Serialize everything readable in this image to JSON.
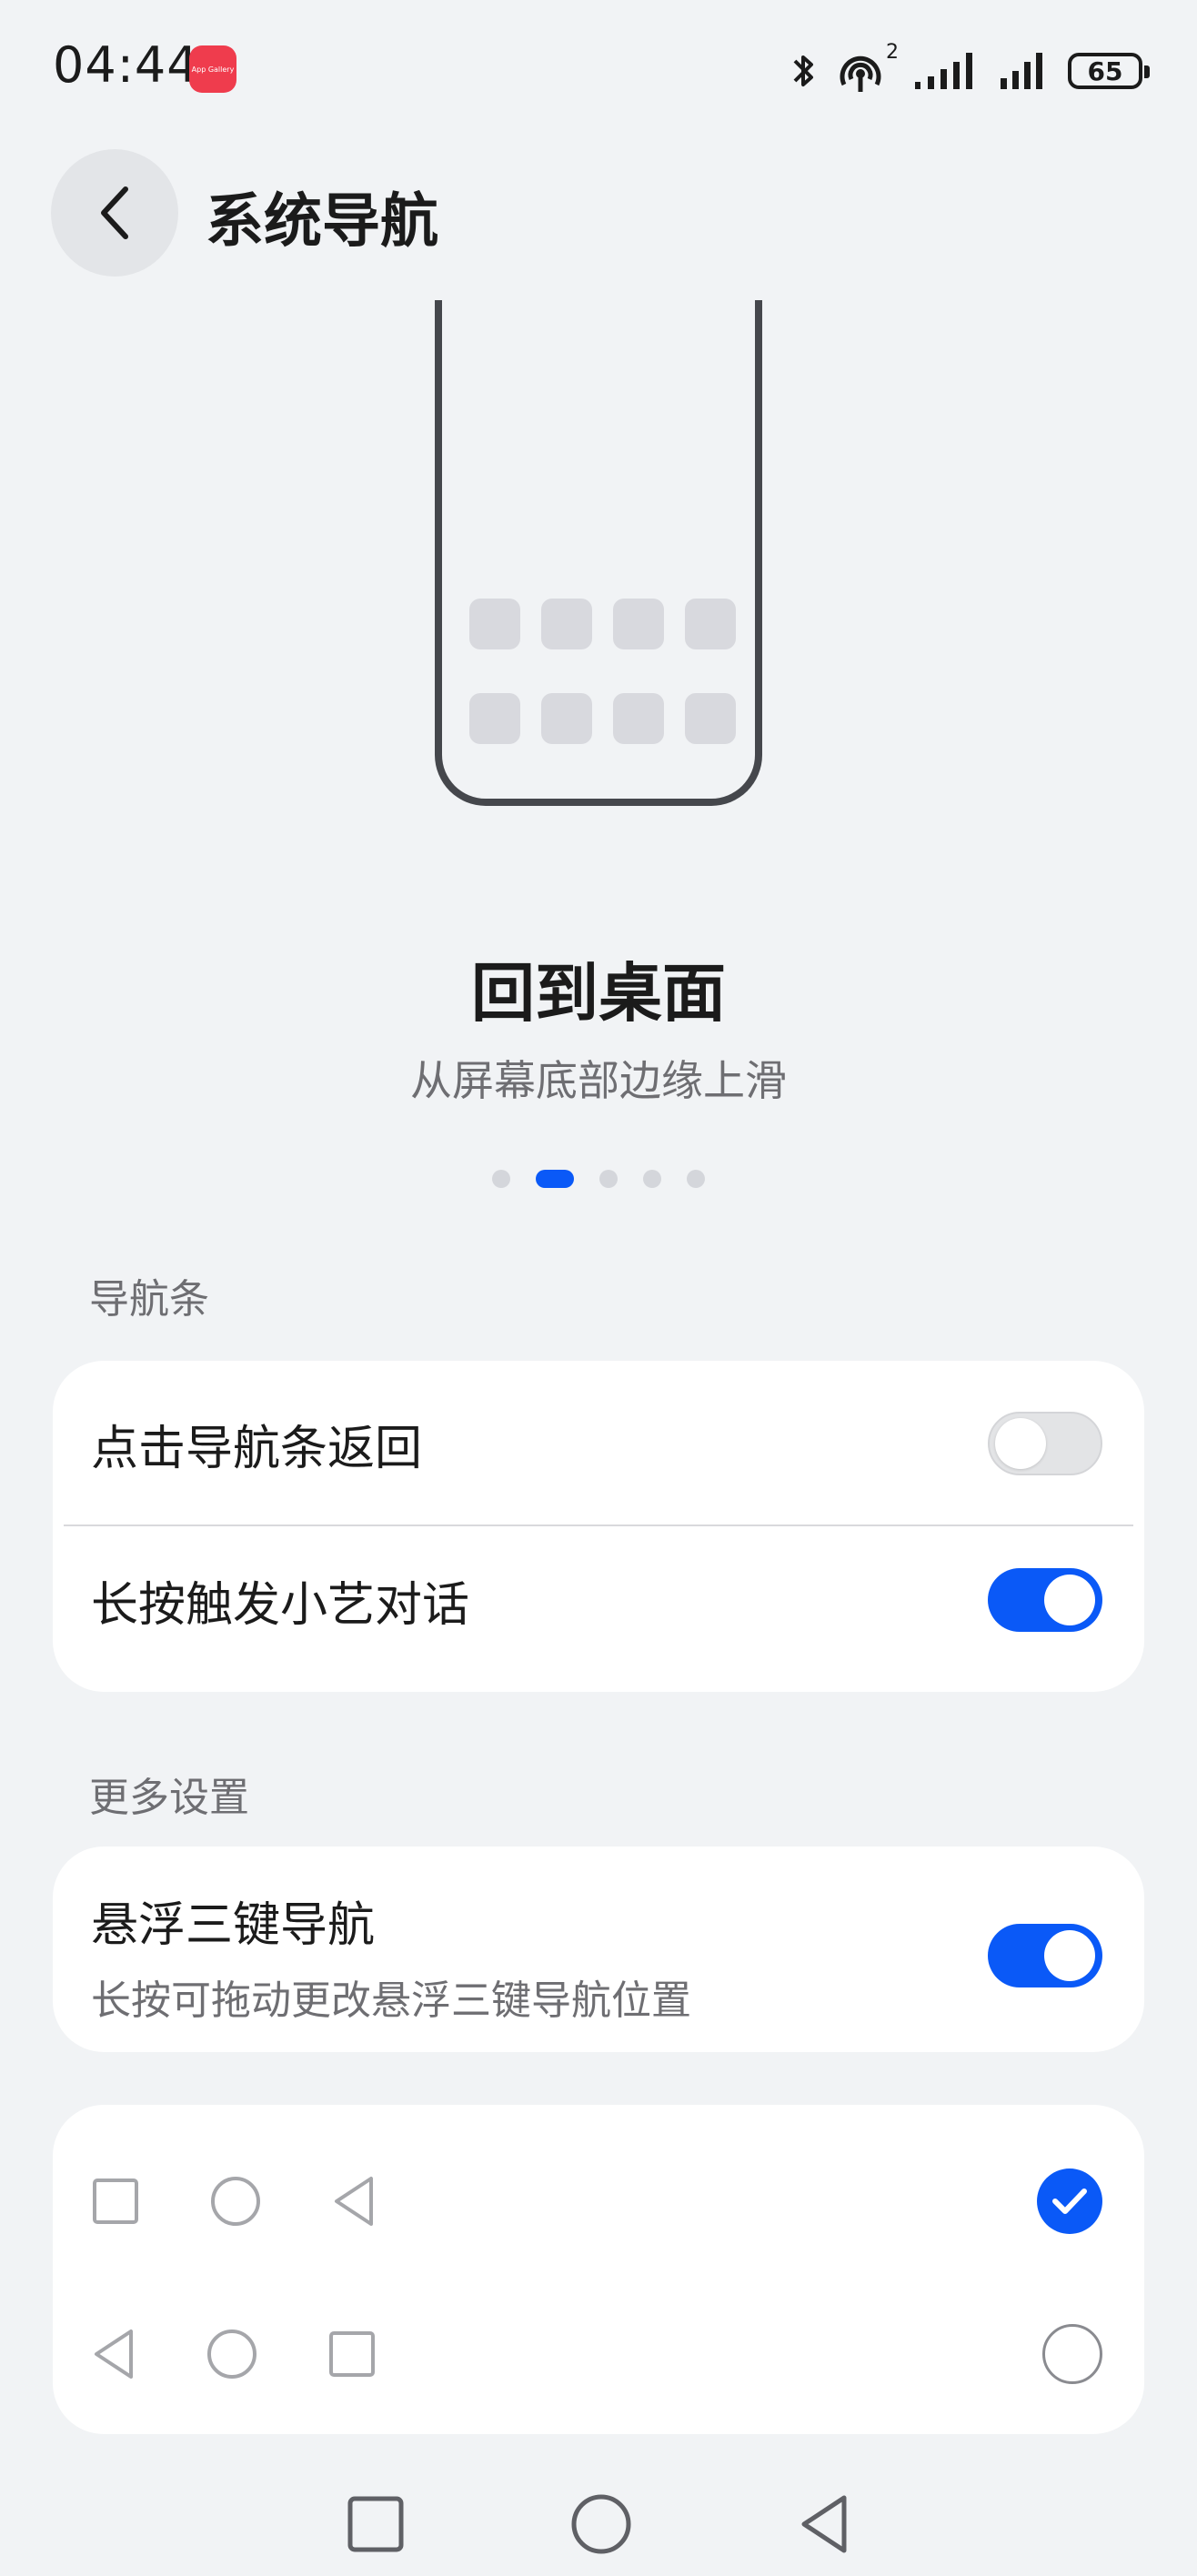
{
  "status_bar": {
    "time": "04:44",
    "app_icon": "app-gallery-icon",
    "app_icon_text": "App Gallery",
    "icons": [
      "bluetooth-icon",
      "hotspot-icon",
      "signal-icon",
      "signal-icon"
    ],
    "hotspot_badge": "2",
    "battery": "65"
  },
  "header": {
    "title": "系统导航"
  },
  "gesture": {
    "title": "回到桌面",
    "subtitle": "从屏幕底部边缘上滑",
    "pages": 5,
    "current_page": 2
  },
  "nav_bar_section": {
    "label": "导航条",
    "items": [
      {
        "label": "点击导航条返回",
        "enabled": false
      },
      {
        "label": "长按触发小艺对话",
        "enabled": true
      }
    ]
  },
  "more_section": {
    "label": "更多设置",
    "floating": {
      "label": "悬浮三键导航",
      "sub": "长按可拖动更改悬浮三键导航位置",
      "enabled": true
    }
  },
  "layout_options": [
    {
      "icons": [
        "square-icon",
        "circle-icon",
        "triangle-back-icon"
      ],
      "selected": true
    },
    {
      "icons": [
        "triangle-back-icon",
        "circle-icon",
        "square-icon"
      ],
      "selected": false
    }
  ],
  "colors": {
    "accent": "#0a59f7",
    "background": "#f1f3f5"
  }
}
